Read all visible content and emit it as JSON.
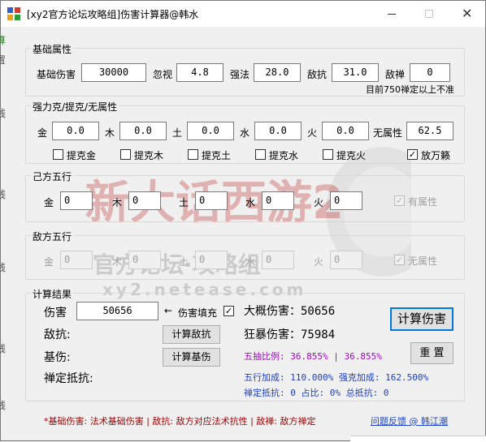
{
  "window": {
    "title": "[xy2官方论坛攻略组]伤害计算器@韩水",
    "colors": {
      "accent": "#0078d7",
      "hint_blue": "#1f3fbf",
      "ratio_purple": "#9a0bb7",
      "note_red": "#a00000"
    }
  },
  "basic": {
    "legend": "基础属性",
    "base_damage_label": "基础伤害",
    "base_damage": "30000",
    "ignore_label": "忽视",
    "ignore": "4.8",
    "strength_label": "强法",
    "strength": "28.0",
    "enemy_resist_label": "敌抗",
    "enemy_resist": "31.0",
    "enemy_zen_label": "敌禅",
    "enemy_zen": "0",
    "note": "目前750禅定以上不准"
  },
  "elements": {
    "legend": "强力克/提克/无属性",
    "metal_label": "金",
    "metal": "0.0",
    "wood_label": "木",
    "wood": "0.0",
    "earth_label": "土",
    "earth": "0.0",
    "water_label": "水",
    "water": "0.0",
    "fire_label": "火",
    "fire": "0.0",
    "none_label": "无属性",
    "none": "62.5",
    "checks": [
      {
        "label": "提克金",
        "checked": false
      },
      {
        "label": "提克木",
        "checked": false
      },
      {
        "label": "提克土",
        "checked": false
      },
      {
        "label": "提克水",
        "checked": false
      },
      {
        "label": "提克火",
        "checked": false
      },
      {
        "label": "放万籁",
        "checked": true
      }
    ]
  },
  "own_five": {
    "legend": "己方五行",
    "metal_label": "金",
    "metal": "0",
    "wood_label": "木",
    "wood": "0",
    "earth_label": "土",
    "earth": "0",
    "water_label": "水",
    "water": "0",
    "fire_label": "火",
    "fire": "0",
    "has_attr_label": "有属性",
    "has_attr_checked": true
  },
  "enemy_five": {
    "legend": "敌方五行",
    "metal_label": "金",
    "metal": "0",
    "wood_label": "木",
    "wood": "0",
    "earth_label": "土",
    "earth": "0",
    "water_label": "水",
    "water": "0",
    "fire_label": "火",
    "fire": "0",
    "no_attr_label": "无属性",
    "no_attr_checked": true
  },
  "results": {
    "legend": "计算结果",
    "damage_label": "伤害",
    "damage": "50656",
    "arrow": "←",
    "fill_label": "伤害填充",
    "fill_checked": true,
    "approx_label": "大概伤害：50656",
    "crit_label": "狂暴伤害：75984",
    "enemy_resist_label": "敌抗:",
    "calc_resist_button": "计算敌抗",
    "base_damage_label": "基伤:",
    "calc_base_button": "计算基伤",
    "zen_label": "禅定抵抗:",
    "ratio_text": "五抽比例: 36.855% | 36.855%",
    "five_bonus_text": "五行加成: 110.000%  强克加成: 162.500%",
    "zen_stats_text": "禅定抵抗: 0  占比: 0%  总抵抗: 0",
    "calc_button": "计算伤害",
    "reset_button": "重 置"
  },
  "footer": {
    "note": "*基础伤害: 法术基础伤害 | 敌抗: 敌方对应法术抗性 | 敌禅: 敌方禅定",
    "feedback_link": "问题反馈 @ 韩江潮"
  },
  "watermark": {
    "line1": "新大话西游2",
    "line2": "官方论坛·攻略组",
    "line3": "xy2.netease.com"
  },
  "background": {
    "left_edge_chars": [
      "算",
      "置",
      "线",
      "线",
      "线",
      "线",
      "线"
    ]
  }
}
